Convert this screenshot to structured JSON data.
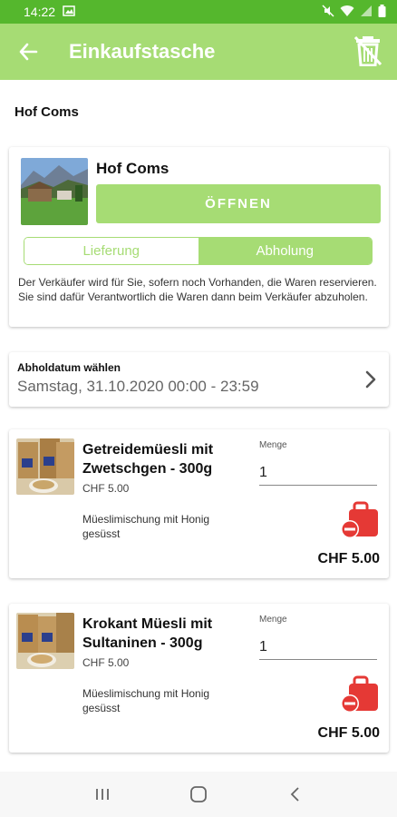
{
  "status_bar": {
    "time": "14:22"
  },
  "app_bar": {
    "title": "Einkaufstasche"
  },
  "shop_heading": "Hof Coms",
  "shop_card": {
    "name": "Hof Coms",
    "open_button": "ÖFFNEN",
    "toggle": {
      "delivery": "Lieferung",
      "pickup": "Abholung",
      "selected": "Abholung"
    },
    "note": "Der Verkäufer wird für Sie, sofern noch Vorhanden, die Waren reservieren. Sie sind dafür Verantwortlich die Waren dann beim Verkäufer abzuholen."
  },
  "pickup_date": {
    "label": "Abholdatum wählen",
    "value": "Samstag, 31.10.2020 00:00 - 23:59"
  },
  "products": [
    {
      "name": "Getreidemüesli mit Zwetschgen - 300g",
      "price": "CHF 5.00",
      "description": "Müeslimischung mit Honig gesüsst",
      "quantity_label": "Menge",
      "quantity": "1",
      "total": "CHF 5.00"
    },
    {
      "name": "Krokant Müesli mit Sultaninen - 300g",
      "price": "CHF 5.00",
      "description": "Müeslimischung mit Honig gesüsst",
      "quantity_label": "Menge",
      "quantity": "1",
      "total": "CHF 5.00"
    }
  ],
  "colors": {
    "status_bar": "#55b72d",
    "accent": "#a6dc74",
    "remove_red": "#e53935"
  },
  "icons": {
    "back": "arrow-left-icon",
    "trash": "trash-off-icon",
    "chevron": "chevron-right-icon",
    "remove": "bag-remove-icon"
  }
}
